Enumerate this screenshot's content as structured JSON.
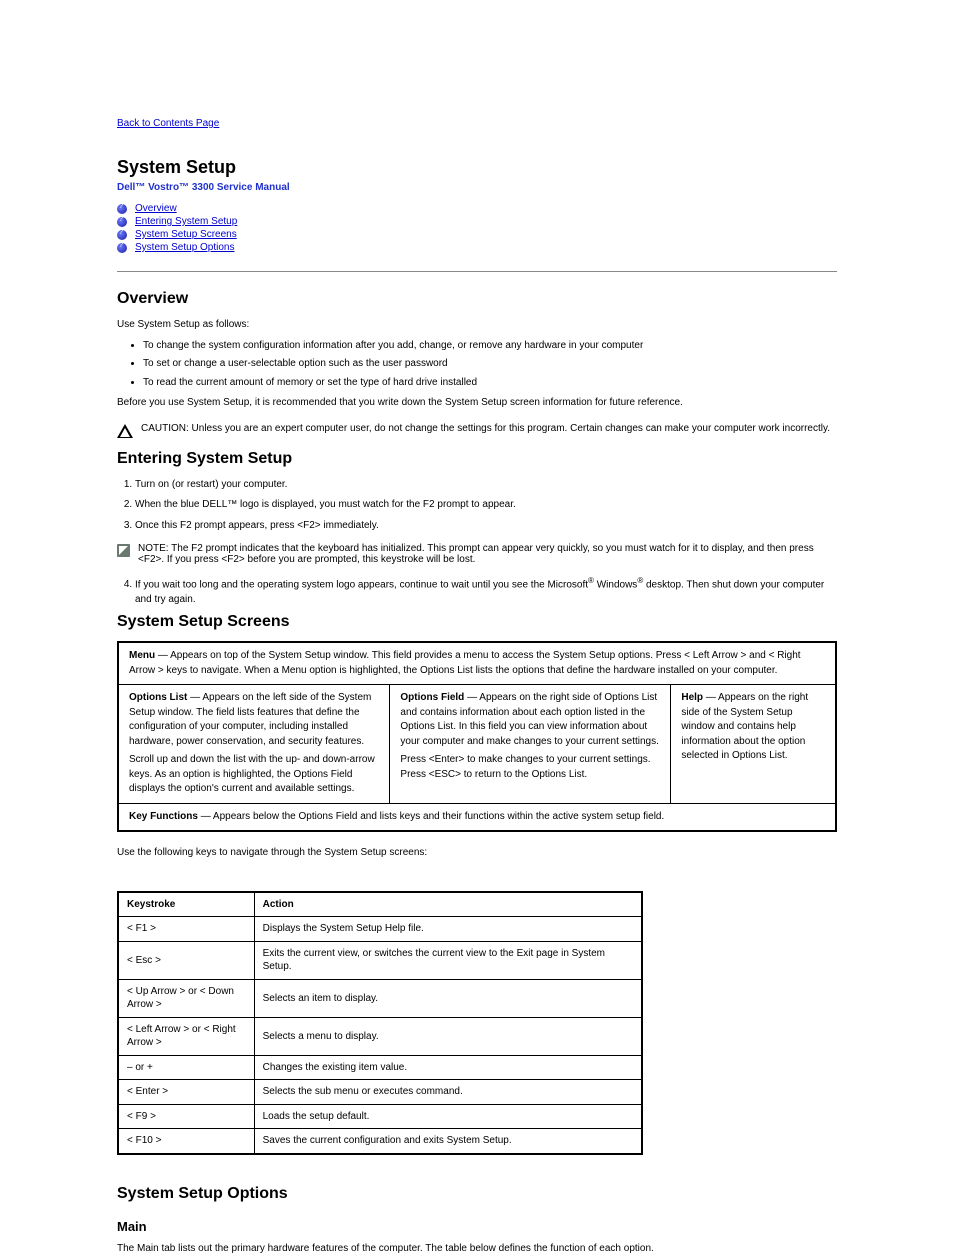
{
  "back_link": "Back to Contents Page",
  "title": "System Setup",
  "subtitle": "Dell™ Vostro™ 3300 Service Manual",
  "toc": [
    {
      "label": "Overview"
    },
    {
      "label": "Entering System Setup"
    },
    {
      "label": "System Setup Screens"
    },
    {
      "label": "System Setup Options"
    }
  ],
  "overview": {
    "heading": "Overview",
    "intro": "Use System Setup as follows:",
    "items": [
      "To change the system configuration information after you add, change, or remove any hardware in your computer",
      "To set or change a user-selectable option such as the user password",
      "To read the current amount of memory or set the type of hard drive installed"
    ],
    "advice": "Before you use System Setup, it is recommended that you write down the System Setup screen information for future reference.",
    "caution": "CAUTION: Unless you are an expert computer user, do not change the settings for this program. Certain changes can make your computer work incorrectly."
  },
  "entering": {
    "heading": "Entering System Setup",
    "steps_1": "Turn on (or restart) your computer.",
    "steps_2": "When the blue DELL™ logo is displayed, you must watch for the F2 prompt to appear.",
    "steps_3": "Once this F2 prompt appears, press <F2> immediately.",
    "note": "NOTE: The F2 prompt indicates that the keyboard has initialized. This prompt can appear very quickly, so you must watch for it to display, and then press <F2>. If you press <F2> before you are prompted, this keystroke will be lost.",
    "steps_4_a": "If you wait too long and the operating system logo appears, continue to wait until you see the Microsoft",
    "steps_4_b": " Windows",
    "steps_4_c": " desktop. Then shut down your computer and try again."
  },
  "screens": {
    "heading": "System Setup Screens",
    "menu": {
      "head": "Menu",
      "body": "— Appears on top of the System Setup window. This field provides a menu to access the System Setup options. Press < Left Arrow > and < Right Arrow > keys to navigate. When a Menu option is highlighted, the Options List lists the options that define the hardware installed on your computer."
    },
    "options": {
      "head": "Options List",
      "body": "— Appears on the left side of the System Setup window. The field lists features that define the configuration of your computer, including installed hardware, power conservation, and security features.",
      "body2": "Scroll up and down the list with the up- and down-arrow keys. As an option is highlighted, the Options Field displays the option's current and available settings."
    },
    "field": {
      "head": "Options Field",
      "body": "— Appears on the right side of Options List and contains information about each option listed in the Options List. In this field you can view information about your computer and make changes to your current settings.",
      "body2": "Press <Enter> to make changes to your current settings. Press <ESC> to return to the Options List."
    },
    "help": {
      "head": "Help",
      "body": "— Appears on the right side of the System Setup window and contains help information about the option selected in Options List."
    },
    "keyfns": {
      "head": "Key Functions",
      "body": "— Appears below the Options Field and lists keys and their functions within the active system setup field."
    }
  },
  "navkeys": {
    "intro": "Use the following keys to navigate through the System Setup screens:",
    "rows": [
      {
        "k": "Keystroke",
        "a": "Action"
      },
      {
        "k": "< F1 >",
        "a": "Displays the System Setup Help file."
      },
      {
        "k": "< Esc >",
        "a": "Exits the current view, or switches the current view to the Exit page in System Setup."
      },
      {
        "k": "< Up Arrow > or < Down Arrow >",
        "a": "Selects an item to display."
      },
      {
        "k": "< Left Arrow > or < Right Arrow >",
        "a": "Selects a menu to display."
      },
      {
        "k": "– or +",
        "a": "Changes the existing item value."
      },
      {
        "k": "< Enter >",
        "a": "Selects the sub menu or executes command."
      },
      {
        "k": "< F9 >",
        "a": "Loads the setup default."
      },
      {
        "k": "< F10 >",
        "a": "Saves the current configuration and exits System Setup."
      }
    ]
  },
  "options_heading": "System Setup Options",
  "main_heading": "Main",
  "main_intro": "The Main tab lists out the primary hardware features of the computer. The table below defines the function of each option."
}
